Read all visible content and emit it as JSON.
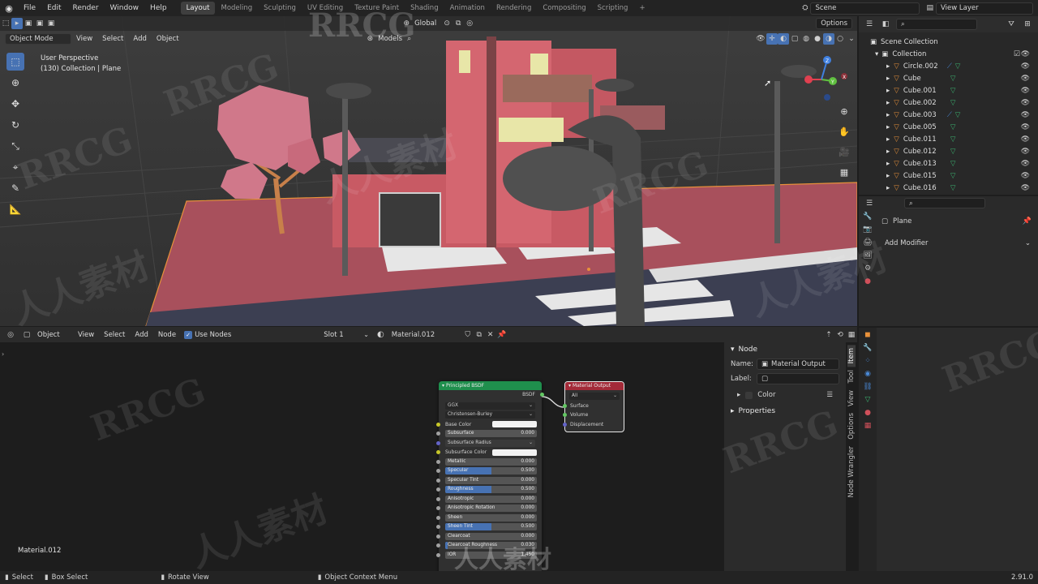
{
  "topbar": {
    "menus": [
      "File",
      "Edit",
      "Render",
      "Window",
      "Help"
    ],
    "workspaces": [
      "Layout",
      "Modeling",
      "Sculpting",
      "UV Editing",
      "Texture Paint",
      "Shading",
      "Animation",
      "Rendering",
      "Compositing",
      "Scripting"
    ],
    "active_workspace": "Layout",
    "add_tab": "+",
    "scene": "Scene",
    "view_layer": "View Layer"
  },
  "viewport": {
    "mode": "Object Mode",
    "menus": [
      "View",
      "Select",
      "Add",
      "Object"
    ],
    "transform_orientation": "Global",
    "options_label": "Options",
    "models_label": "Models",
    "info_line1": "User Perspective",
    "info_line2": "(130) Collection | Plane",
    "gizmo_axes": [
      "X",
      "Y",
      "Z"
    ]
  },
  "outliner": {
    "root": "Scene Collection",
    "collection": "Collection",
    "items": [
      {
        "name": "Circle.002",
        "type": "curve"
      },
      {
        "name": "Cube",
        "type": "mesh"
      },
      {
        "name": "Cube.001",
        "type": "mesh"
      },
      {
        "name": "Cube.002",
        "type": "mesh"
      },
      {
        "name": "Cube.003",
        "type": "curve"
      },
      {
        "name": "Cube.005",
        "type": "mesh"
      },
      {
        "name": "Cube.011",
        "type": "mesh"
      },
      {
        "name": "Cube.012",
        "type": "mesh"
      },
      {
        "name": "Cube.013",
        "type": "mesh"
      },
      {
        "name": "Cube.015",
        "type": "mesh"
      },
      {
        "name": "Cube.016",
        "type": "mesh"
      }
    ]
  },
  "properties": {
    "object_name": "Plane",
    "add_modifier": "Add Modifier"
  },
  "node_editor": {
    "editor_type": "Object",
    "menus": [
      "View",
      "Select",
      "Add",
      "Node"
    ],
    "use_nodes_label": "Use Nodes",
    "slot": "Slot 1",
    "material": "Material.012",
    "footer_material": "Material.012"
  },
  "bsdf_node": {
    "title": "Principled BSDF",
    "output": "BSDF",
    "distribution": "GGX",
    "subsurface_method": "Christensen-Burley",
    "base_color_label": "Base Color",
    "subsurface_radius_label": "Subsurface Radius",
    "subsurface_color_label": "Subsurface Color",
    "inputs": [
      {
        "label": "Subsurface",
        "value": "0.000",
        "fill": 0
      },
      {
        "label": "Metallic",
        "value": "0.000",
        "fill": 0
      },
      {
        "label": "Specular",
        "value": "0.500",
        "fill": 0.5
      },
      {
        "label": "Specular Tint",
        "value": "0.000",
        "fill": 0
      },
      {
        "label": "Roughness",
        "value": "0.500",
        "fill": 0.5
      },
      {
        "label": "Anisotropic",
        "value": "0.000",
        "fill": 0
      },
      {
        "label": "Anisotropic Rotation",
        "value": "0.000",
        "fill": 0
      },
      {
        "label": "Sheen",
        "value": "0.000",
        "fill": 0
      },
      {
        "label": "Sheen Tint",
        "value": "0.500",
        "fill": 0.5
      },
      {
        "label": "Clearcoat",
        "value": "0.000",
        "fill": 0
      },
      {
        "label": "Clearcoat Roughness",
        "value": "0.030",
        "fill": 0.03
      },
      {
        "label": "IOR",
        "value": "1.450",
        "fill": 0
      }
    ]
  },
  "output_node": {
    "title": "Material Output",
    "target": "All",
    "sockets": [
      "Surface",
      "Volume",
      "Displacement"
    ]
  },
  "sidebar": {
    "section": "Node",
    "name_label": "Name:",
    "name_value": "Material Output",
    "label_label": "Label:",
    "color_label": "Color",
    "properties_label": "Properties",
    "tabs": [
      "Item",
      "Tool",
      "View",
      "Options",
      "Node Wrangler"
    ]
  },
  "statusbar": {
    "select": "Select",
    "box_select": "Box Select",
    "rotate_view": "Rotate View",
    "context_menu": "Object Context Menu",
    "version": "2.91.0"
  },
  "watermarks": [
    "RRCG",
    "人人素材"
  ],
  "colors": {
    "accent": "#4772b3",
    "active_outline": "#e8913a",
    "bsdf_header": "#1f8f4d",
    "output_header": "#a32a38",
    "socket_yellow": "#c7c729",
    "socket_gray": "#a1a1a1",
    "socket_purple": "#6363c7",
    "socket_green": "#63c763"
  }
}
